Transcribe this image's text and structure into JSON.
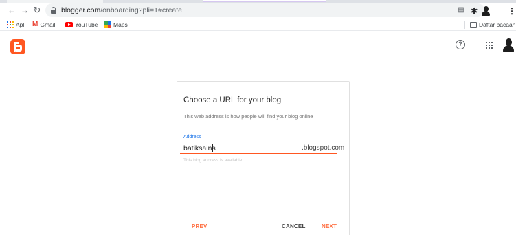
{
  "browser": {
    "url_host": "blogger.com",
    "url_rest": "/onboarding?pli=1#create",
    "bookmarks": [
      {
        "label": "Apl",
        "icon": "apps-grid-icon"
      },
      {
        "label": "Gmail",
        "icon": "gmail-icon"
      },
      {
        "label": "YouTube",
        "icon": "youtube-icon"
      },
      {
        "label": "Maps",
        "icon": "maps-icon"
      }
    ],
    "reading_list_label": "Daftar bacaan"
  },
  "app": {
    "logo": "blogger-logo",
    "help_glyph": "?",
    "accent_color": "#ff5722"
  },
  "card": {
    "title": "Choose a URL for your blog",
    "description": "This web address is how people will find your blog online",
    "address_label": "Address",
    "address_value": "batiksains",
    "address_suffix": ".blogspot.com",
    "helper_text": "This blog address is available",
    "buttons": {
      "prev": "PREV",
      "cancel": "CANCEL",
      "next": "NEXT"
    }
  }
}
